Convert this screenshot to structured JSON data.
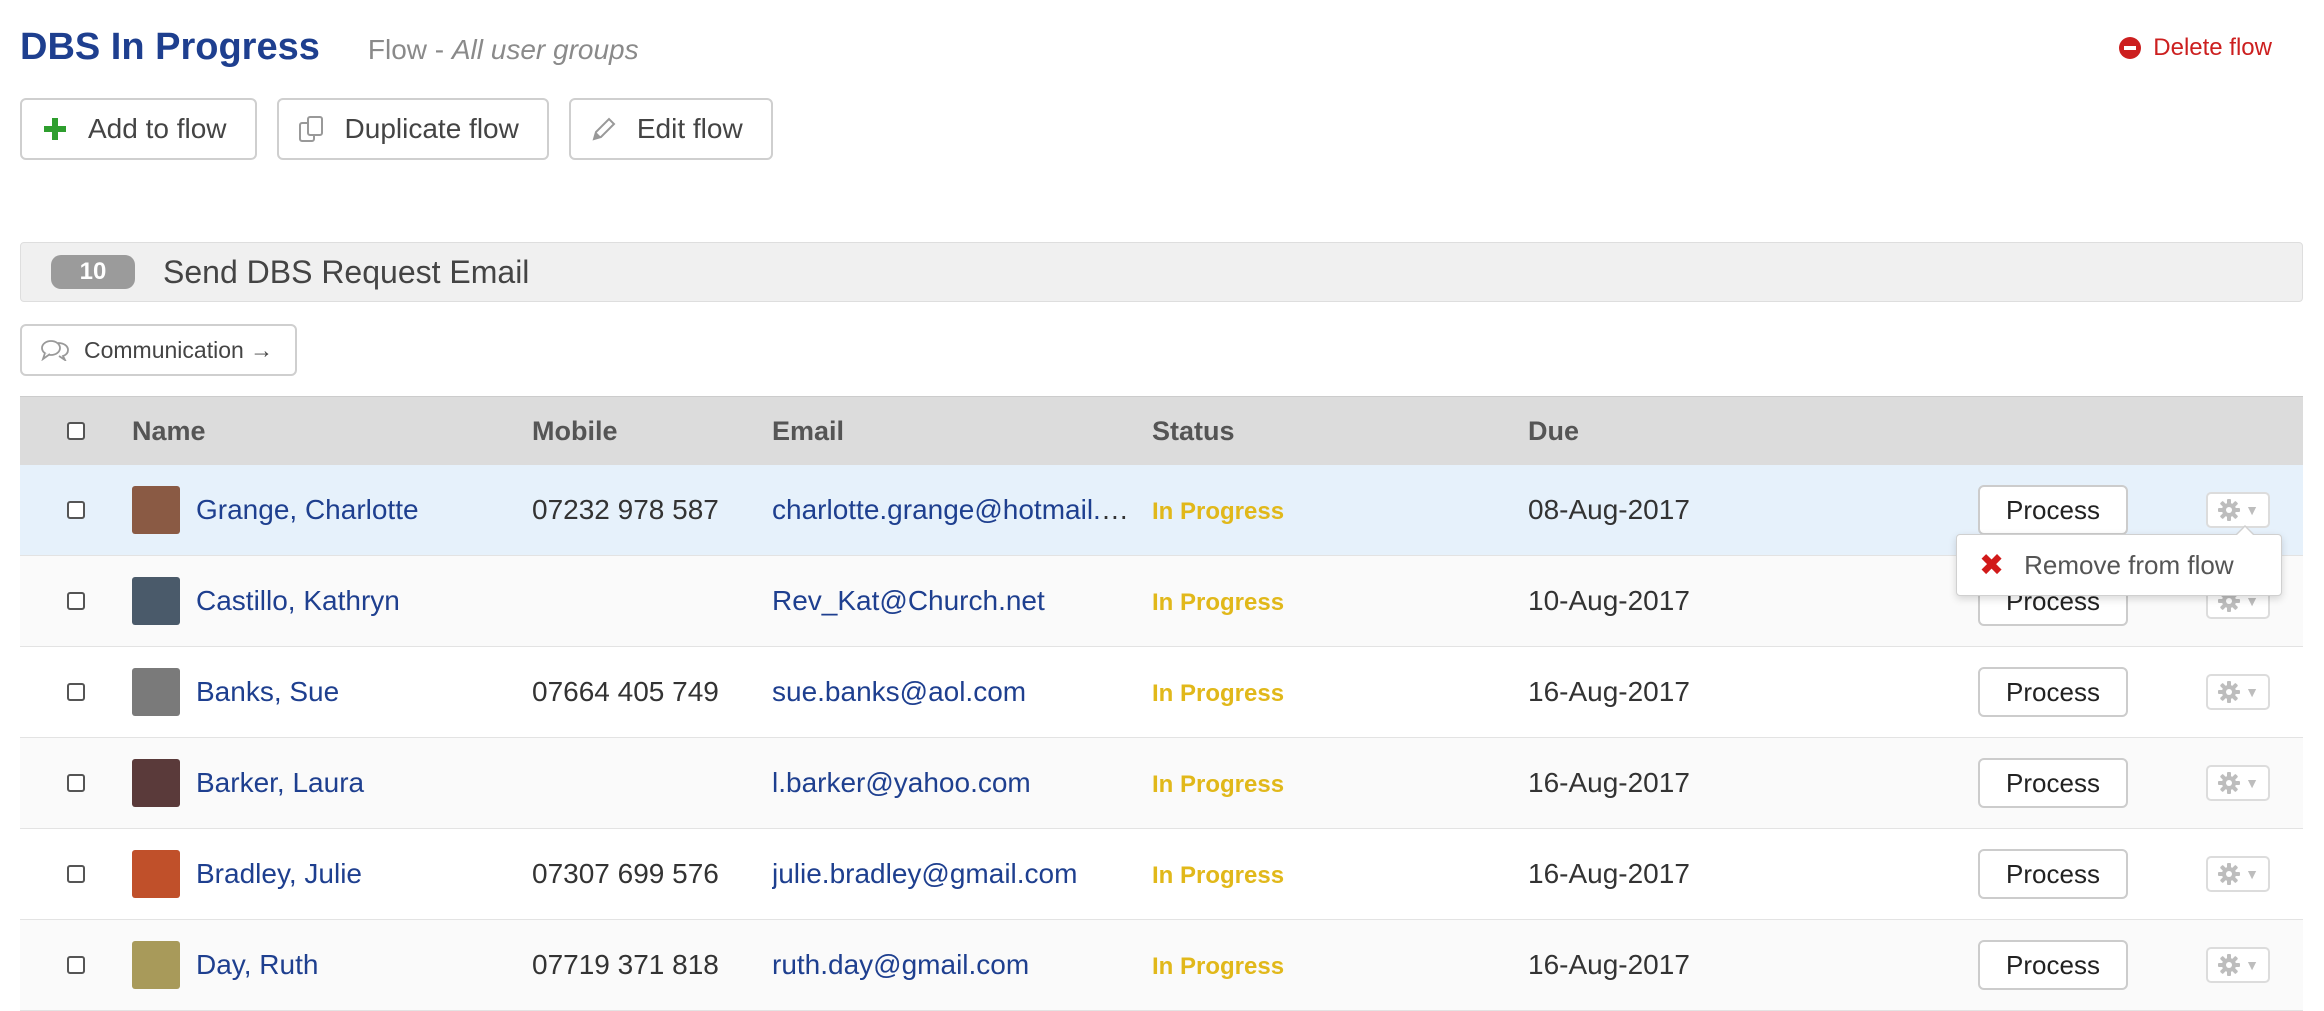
{
  "header": {
    "title": "DBS In Progress",
    "subtitle_prefix": "Flow - ",
    "subtitle_groups": "All user groups",
    "delete_label": "Delete flow"
  },
  "actions": {
    "add_label": "Add to flow",
    "duplicate_label": "Duplicate flow",
    "edit_label": "Edit flow"
  },
  "step": {
    "count": "10",
    "title": "Send DBS Request Email",
    "communication_label": "Communication →"
  },
  "table": {
    "columns": {
      "name": "Name",
      "mobile": "Mobile",
      "email": "Email",
      "status": "Status",
      "due": "Due"
    },
    "process_label": "Process",
    "rows": [
      {
        "name": "Grange, Charlotte",
        "mobile": "07232 978 587",
        "email": "charlotte.grange@hotmail.com",
        "status": "In Progress",
        "due": "08-Aug-2017",
        "avatar_color": "#8a5a44"
      },
      {
        "name": "Castillo, Kathryn",
        "mobile": "",
        "email": "Rev_Kat@Church.net",
        "status": "In Progress",
        "due": "10-Aug-2017",
        "avatar_color": "#4a5a6a"
      },
      {
        "name": "Banks, Sue",
        "mobile": "07664 405 749",
        "email": "sue.banks@aol.com",
        "status": "In Progress",
        "due": "16-Aug-2017",
        "avatar_color": "#7a7a7a"
      },
      {
        "name": "Barker, Laura",
        "mobile": "",
        "email": "l.barker@yahoo.com",
        "status": "In Progress",
        "due": "16-Aug-2017",
        "avatar_color": "#5a3a3a"
      },
      {
        "name": "Bradley, Julie",
        "mobile": "07307 699 576",
        "email": "julie.bradley@gmail.com",
        "status": "In Progress",
        "due": "16-Aug-2017",
        "avatar_color": "#c0502a"
      },
      {
        "name": "Day, Ruth",
        "mobile": "07719 371 818",
        "email": "ruth.day@gmail.com",
        "status": "In Progress",
        "due": "16-Aug-2017",
        "avatar_color": "#a89a5a"
      }
    ]
  },
  "dropdown": {
    "remove_label": "Remove from flow"
  },
  "colors": {
    "accent": "#1e3f8f",
    "status": "#e1b81a",
    "danger": "#cc1f1f",
    "add": "#2e9e2e"
  }
}
